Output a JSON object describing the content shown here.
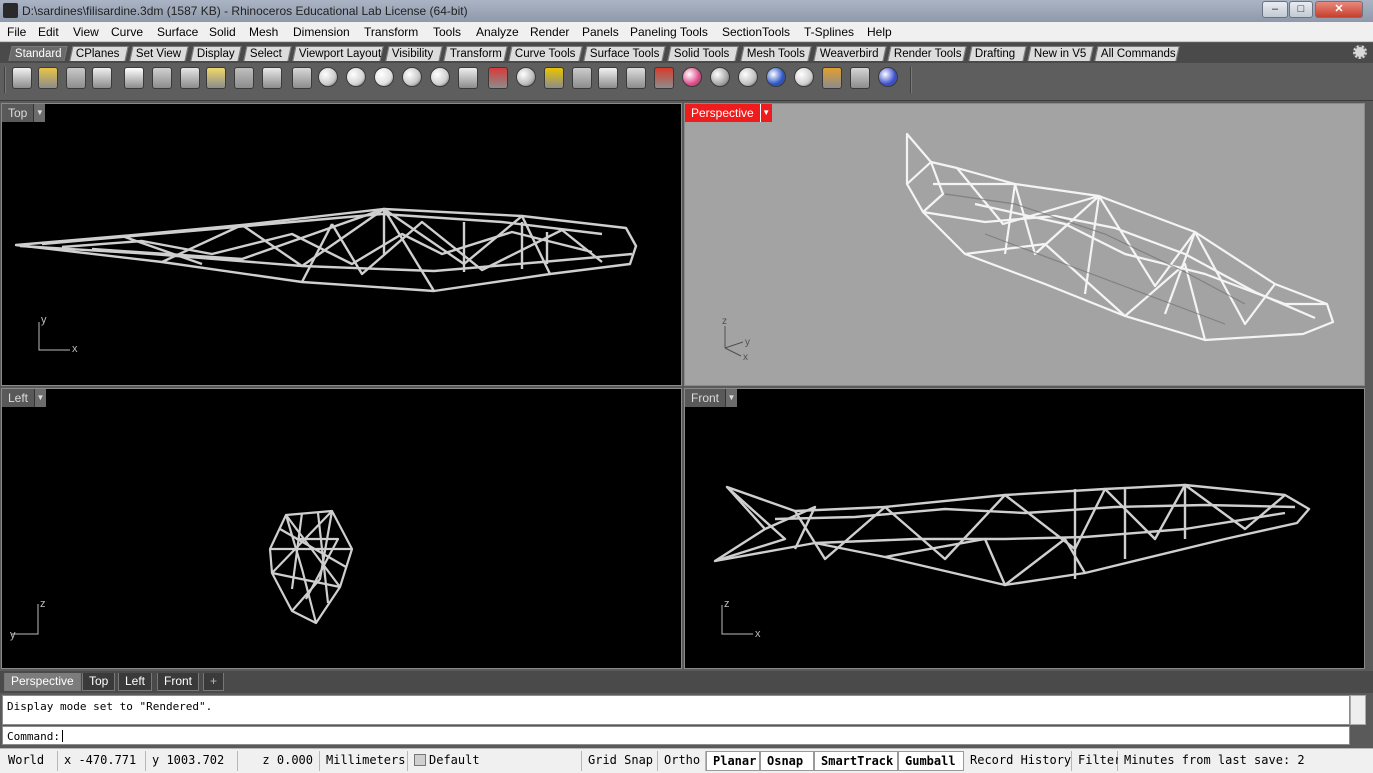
{
  "window": {
    "title": "D:\\sardines\\filisardine.3dm (1587 KB) - Rhinoceros Educational Lab License (64-bit)",
    "minimize": "–",
    "maximize": "□",
    "close": "✕"
  },
  "menu": [
    "File",
    "Edit",
    "View",
    "Curve",
    "Surface",
    "Solid",
    "Mesh",
    "Dimension",
    "Transform",
    "Tools",
    "Analyze",
    "Render",
    "Panels",
    "Paneling Tools",
    "SectionTools",
    "T-Splines",
    "Help"
  ],
  "toolbar_tabs": [
    "Standard",
    "CPlanes",
    "Set View",
    "Display",
    "Select",
    "Viewport Layout",
    "Visibility",
    "Transform",
    "Curve Tools",
    "Surface Tools",
    "Solid Tools",
    "Mesh Tools",
    "Weaverbird",
    "Render Tools",
    "Drafting",
    "New in V5",
    "All Commands"
  ],
  "toolbar_icons": [
    "new-icon",
    "open-icon",
    "save-icon",
    "print-icon",
    "properties-icon",
    "cut-icon",
    "copy-icon",
    "paste-icon",
    "undo-icon",
    "pan-hand-icon",
    "rotate-view-icon",
    "zoom-icon",
    "zoom-window-icon",
    "zoom-extents-icon",
    "zoom-selected-icon",
    "zoom-target-icon",
    "four-viewports-icon",
    "car-icon",
    "point-icon",
    "snap-icon",
    "select-icon",
    "light-icon",
    "lock-icon",
    "layer-icon",
    "color-wheel-icon",
    "sphere-gray-icon",
    "sphere-shaded-icon",
    "sphere-blue-icon",
    "rendered-sphere-icon",
    "options-gear-icon",
    "grid-options-icon",
    "help-icon"
  ],
  "viewports": {
    "top": "Top",
    "perspective": "Perspective",
    "left": "Left",
    "front": "Front"
  },
  "axes": {
    "x": "x",
    "y": "y",
    "z": "z"
  },
  "viewport_tabs": [
    "Perspective",
    "Top",
    "Left",
    "Front"
  ],
  "viewport_tab_add": "+",
  "command": {
    "history": "Display mode set to \"Rendered\".",
    "prompt": "Command:"
  },
  "status": {
    "cplane": "World",
    "x": "x -470.771",
    "y": "y 1003.702",
    "z": "z 0.000",
    "units": "Millimeters",
    "layer": "Default",
    "grid_snap": "Grid Snap",
    "ortho": "Ortho",
    "planar": "Planar",
    "osnap": "Osnap",
    "smarttrack": "SmartTrack",
    "gumball": "Gumball",
    "record_history": "Record History",
    "filter": "Filter",
    "save_info": "Minutes from last save: 2"
  },
  "colors": {
    "active_viewport": "#ee1c1c",
    "perspective_bg": "#a3a3a3",
    "wireframe": "#cfcfcf"
  }
}
